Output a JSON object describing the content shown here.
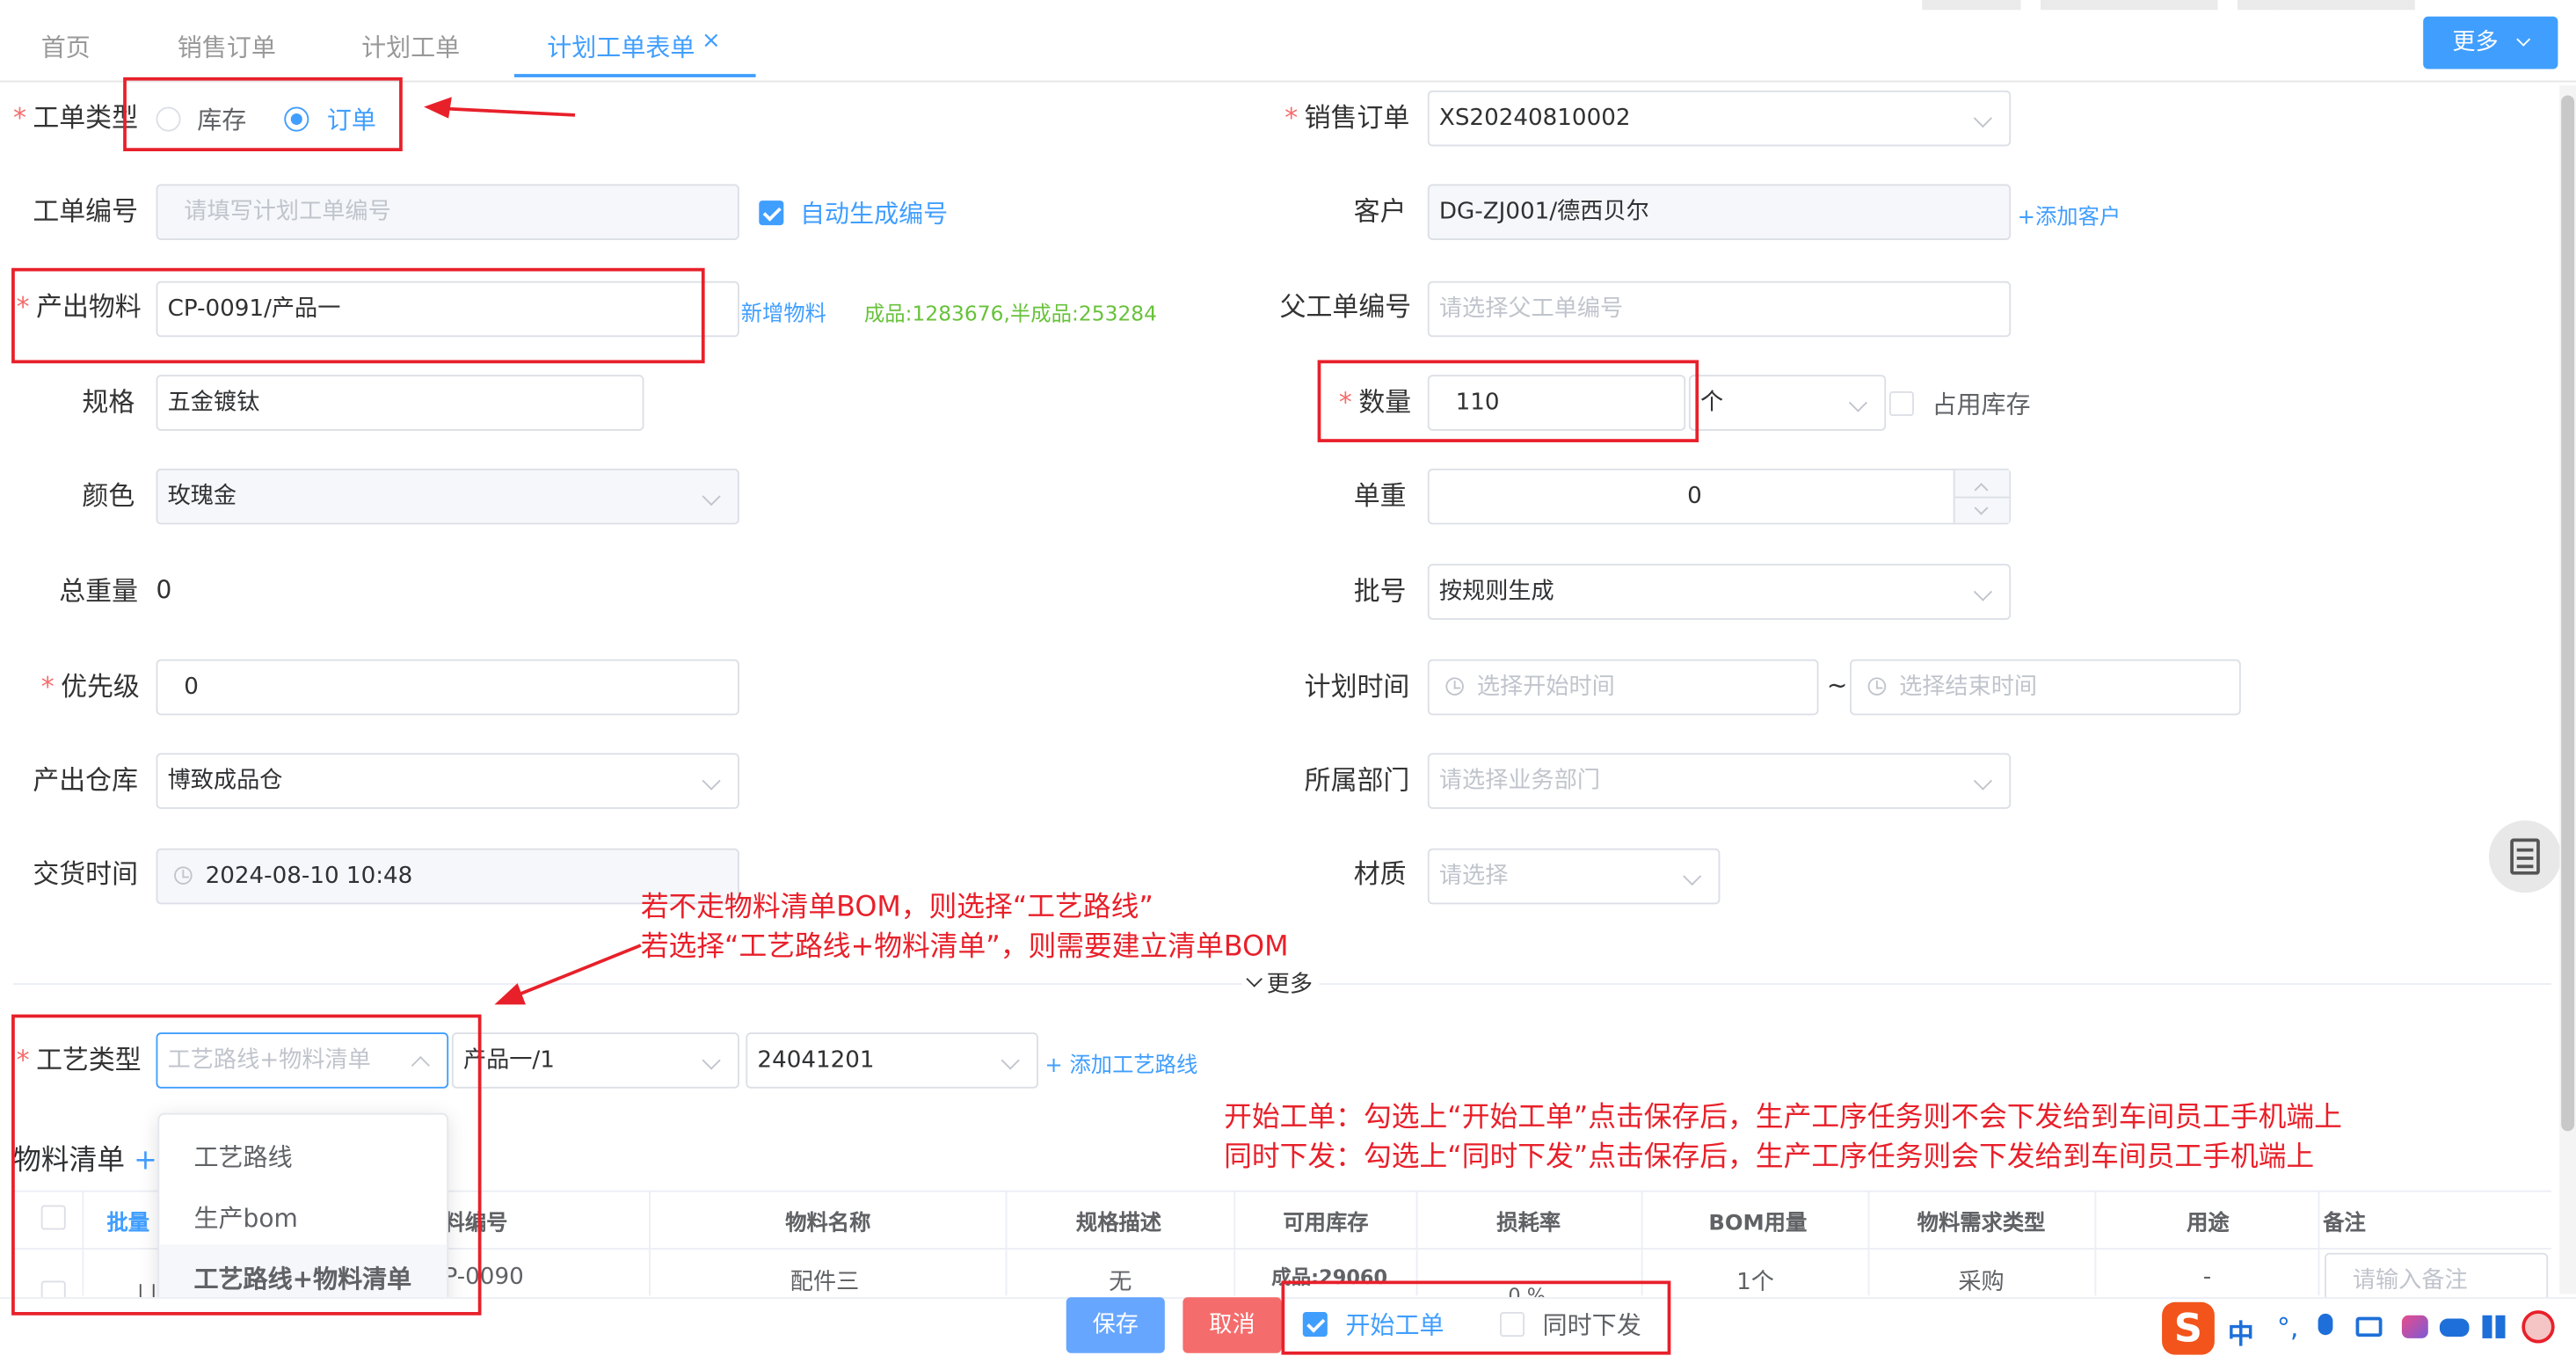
{
  "tabs": {
    "home": "首页",
    "sales_order": "销售订单",
    "plan_work_order": "计划工单",
    "plan_form": "计划工单表单",
    "more_button": "更多"
  },
  "form": {
    "order_type_label": "工单类型",
    "order_type_opt_stock": "库存",
    "order_type_opt_order": "订单",
    "sales_order_label": "销售订单",
    "sales_order_value": "XS20240810002",
    "order_no_label": "工单编号",
    "order_no_placeholder": "请填写计划工单编号",
    "auto_gen_label": "自动生成编号",
    "customer_label": "客户",
    "customer_value": "DG-ZJ001/德西贝尔",
    "add_customer_link": "添加客户",
    "output_material_label": "产出物料",
    "output_material_value": "CP-0091/产品一",
    "new_material_link": "新增物料",
    "stock_info": "成品:1283676,半成品:253284",
    "parent_order_label": "父工单编号",
    "parent_order_placeholder": "请选择父工单编号",
    "spec_label": "规格",
    "spec_value": "五金镀钛",
    "quantity_label": "数量",
    "quantity_value": "110",
    "unit_value": "个",
    "occupy_stock_label": "占用库存",
    "color_label": "颜色",
    "color_value": "玫瑰金",
    "unit_weight_label": "单重",
    "unit_weight_value": "0",
    "total_weight_label": "总重量",
    "total_weight_value": "0",
    "batch_label": "批号",
    "batch_value": "按规则生成",
    "priority_label": "优先级",
    "priority_value": "0",
    "plan_time_label": "计划时间",
    "start_time_placeholder": "选择开始时间",
    "time_separator": "~",
    "end_time_placeholder": "选择结束时间",
    "warehouse_label": "产出仓库",
    "warehouse_value": "博致成品仓",
    "department_label": "所属部门",
    "department_placeholder": "请选择业务部门",
    "delivery_label": "交货时间",
    "delivery_value": "2024-08-10 10:48",
    "material_quality_label": "材质",
    "material_quality_placeholder": "请选择",
    "more_toggle": "更多",
    "process_type_label": "工艺类型",
    "process_type_value": "工艺路线+物料清单",
    "route_select_value": "产品一/1",
    "bom_select_value": "24041201",
    "add_route_link": "添加工艺路线"
  },
  "dropdown": {
    "options": [
      "工艺路线",
      "生产bom",
      "工艺路线+物料清单"
    ]
  },
  "material_list": {
    "title": "物料清单",
    "plus": "+",
    "batch_label": "批量",
    "columns": [
      "料编号",
      "物料名称",
      "规格描述",
      "可用库存",
      "损耗率",
      "BOM用量",
      "物料需求类型",
      "用途",
      "备注"
    ],
    "row": {
      "code": "P-0090",
      "name": "配件三",
      "spec": "无",
      "stock": "成品:29060",
      "loss": "0 %",
      "bom_qty": "1个",
      "demand_type": "采购",
      "usage": "-",
      "remark_placeholder": "请输入备注"
    }
  },
  "footer": {
    "save": "保存",
    "cancel": "取消",
    "start_order": "开始工单",
    "issue_together": "同时下发"
  },
  "annotations": {
    "bom_line1": "若不走物料清单BOM，则选择“工艺路线”",
    "bom_line2": "若选择“工艺路线+物料清单”，则需要建立清单BOM",
    "start_line1": "开始工单：勾选上“开始工单”点击保存后，生产工序任务则不会下发给到车间员工手机端上",
    "start_line2": "同时下发：勾选上“同时下发”点击保存后，生产工序任务则会下发给到车间员工手机端上"
  },
  "ime": {
    "zh_label": "中"
  },
  "colors": {
    "primary": "#409eff",
    "annotation_red": "#e8202a",
    "stock_green": "#67c23a",
    "cancel_red": "#f56c6c"
  }
}
